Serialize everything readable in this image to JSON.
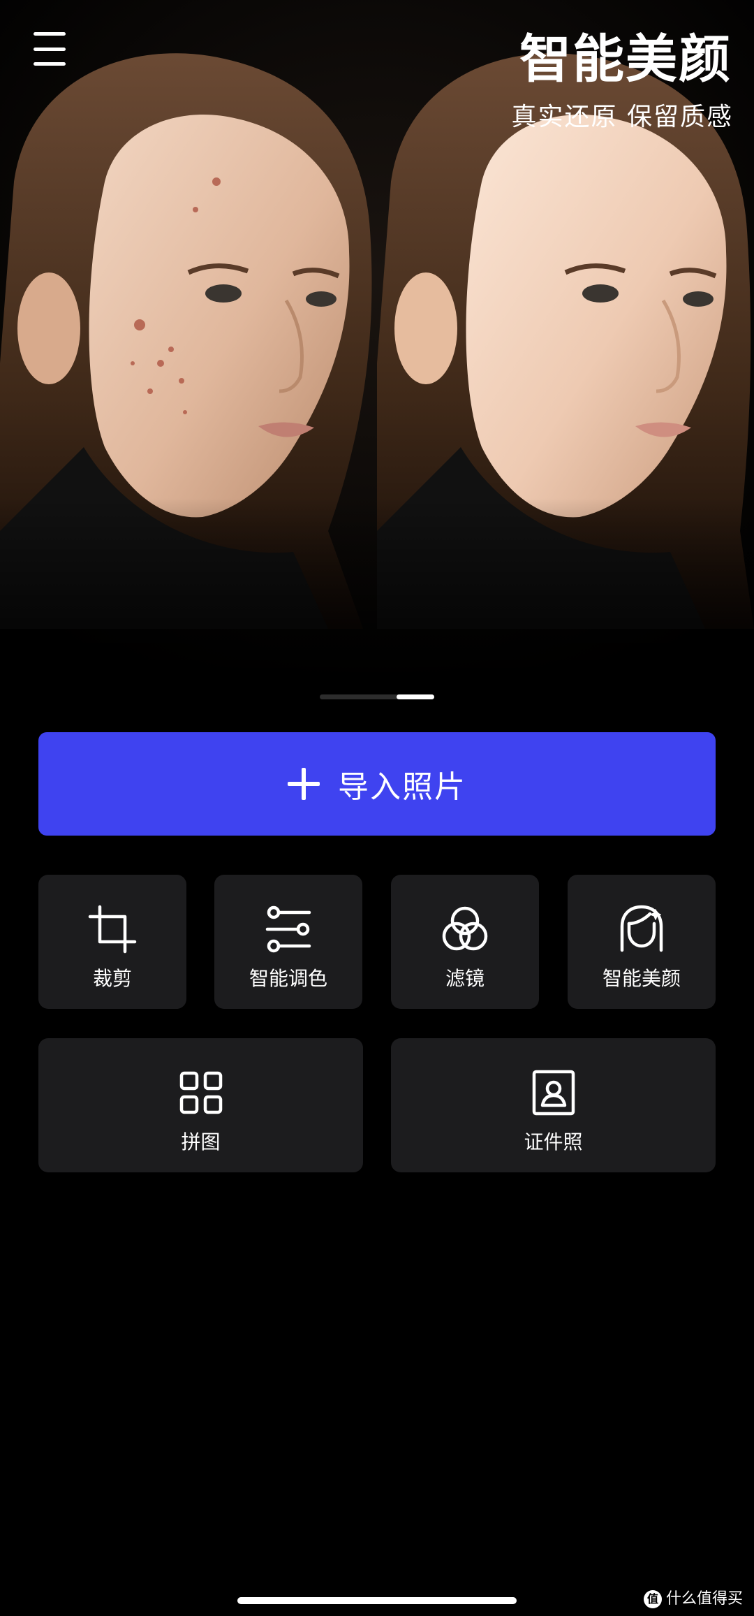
{
  "hero": {
    "title": "智能美颜",
    "subtitle": "真实还原  保留质感",
    "pager": {
      "count": 2,
      "active_index": 1
    }
  },
  "header": {
    "menu_icon": "hamburger-menu-icon"
  },
  "import_button": {
    "label": "导入照片",
    "icon": "plus-icon",
    "color": "#3f43f0"
  },
  "tools": [
    {
      "label": "裁剪",
      "icon": "crop-icon"
    },
    {
      "label": "智能调色",
      "icon": "adjust-sliders-icon"
    },
    {
      "label": "滤镜",
      "icon": "filter-circles-icon"
    },
    {
      "label": "智能美颜",
      "icon": "beauty-face-icon"
    },
    {
      "label": "拼图",
      "icon": "collage-grid-icon"
    },
    {
      "label": "证件照",
      "icon": "id-photo-icon"
    }
  ],
  "watermark": {
    "logo": "值",
    "text": "什么值得买"
  },
  "colors": {
    "background": "#000000",
    "card": "#1c1c1e",
    "accent": "#3f43f0"
  }
}
